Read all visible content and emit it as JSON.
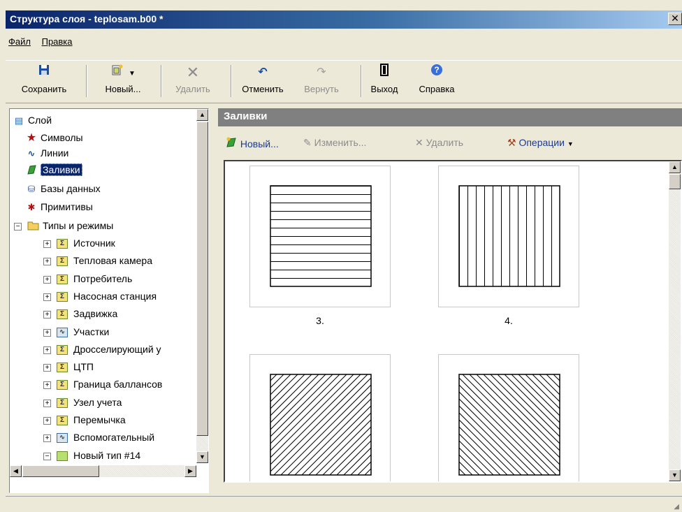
{
  "window": {
    "title": "Структура слоя - teplosam.b00 *",
    "close": "✕"
  },
  "menu": [
    "Файл",
    "Правка"
  ],
  "toolbar": {
    "save": "Сохранить",
    "new": "Новый...",
    "delete": "Удалить",
    "undo": "Отменить",
    "redo": "Вернуть",
    "exit": "Выход",
    "help": "Справка"
  },
  "tree": {
    "root": "Слой",
    "items": [
      "Символы",
      "Линии",
      "Заливки",
      "Базы данных",
      "Примитивы"
    ],
    "group": "Типы и режимы",
    "types": [
      "Источник",
      "Тепловая камера",
      "Потребитель",
      "Насосная станция",
      "Задвижка",
      "Участки",
      "Дросселирующий у",
      "ЦТП",
      "Граница баллансов",
      "Узел учета",
      "Перемычка",
      "Вспомогательный",
      "Новый тип #14"
    ],
    "partial": "Н..."
  },
  "panel": {
    "title": "Заливки",
    "actions": {
      "new": "Новый...",
      "edit": "Изменить...",
      "delete": "Удалить",
      "ops": "Операции"
    }
  },
  "fills": [
    {
      "label": "3.",
      "pattern": "horizontal"
    },
    {
      "label": "4.",
      "pattern": "vertical"
    },
    {
      "label": "",
      "pattern": "diagonal-up"
    },
    {
      "label": "",
      "pattern": "diagonal-down"
    }
  ]
}
